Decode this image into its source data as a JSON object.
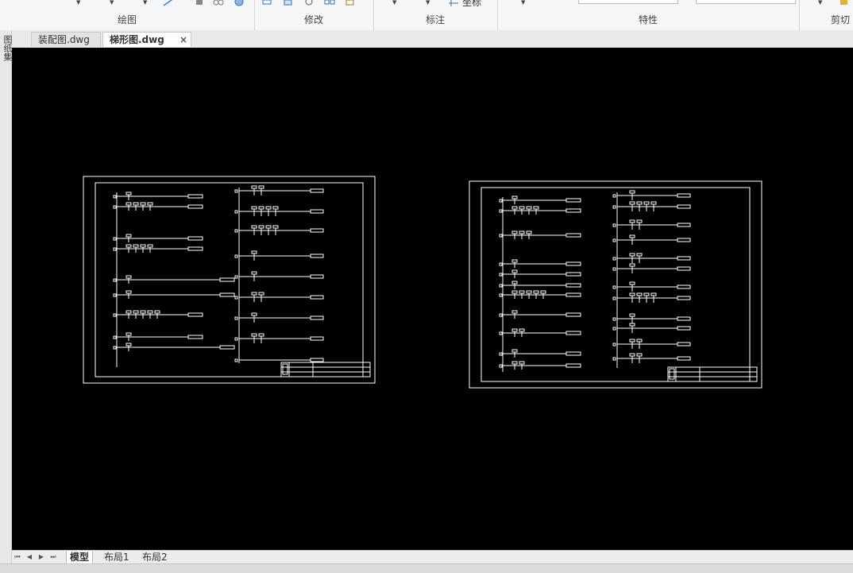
{
  "ribbon": {
    "groups": [
      "绘图",
      "修改",
      "标注",
      "特性",
      "剪切"
    ],
    "mark_partial": "坐标"
  },
  "left_strip": {
    "label": "图纸集"
  },
  "document_tabs": [
    {
      "label": "装配图.dwg",
      "active": false
    },
    {
      "label": "梯形图.dwg",
      "active": true,
      "close": "×"
    }
  ],
  "layout_tabs": [
    {
      "label": "模型",
      "active": true
    },
    {
      "label": "布局1",
      "active": false
    },
    {
      "label": "布局2",
      "active": false
    }
  ],
  "layout_nav": [
    "⏮",
    "◀",
    "▶",
    "⏭"
  ],
  "canvas": {
    "background": "#000000",
    "line_color": "#ffffff"
  },
  "icons": [
    "draw-line-icon",
    "modify-icon",
    "rotate-icon",
    "dimension-icon",
    "layer-icon"
  ]
}
